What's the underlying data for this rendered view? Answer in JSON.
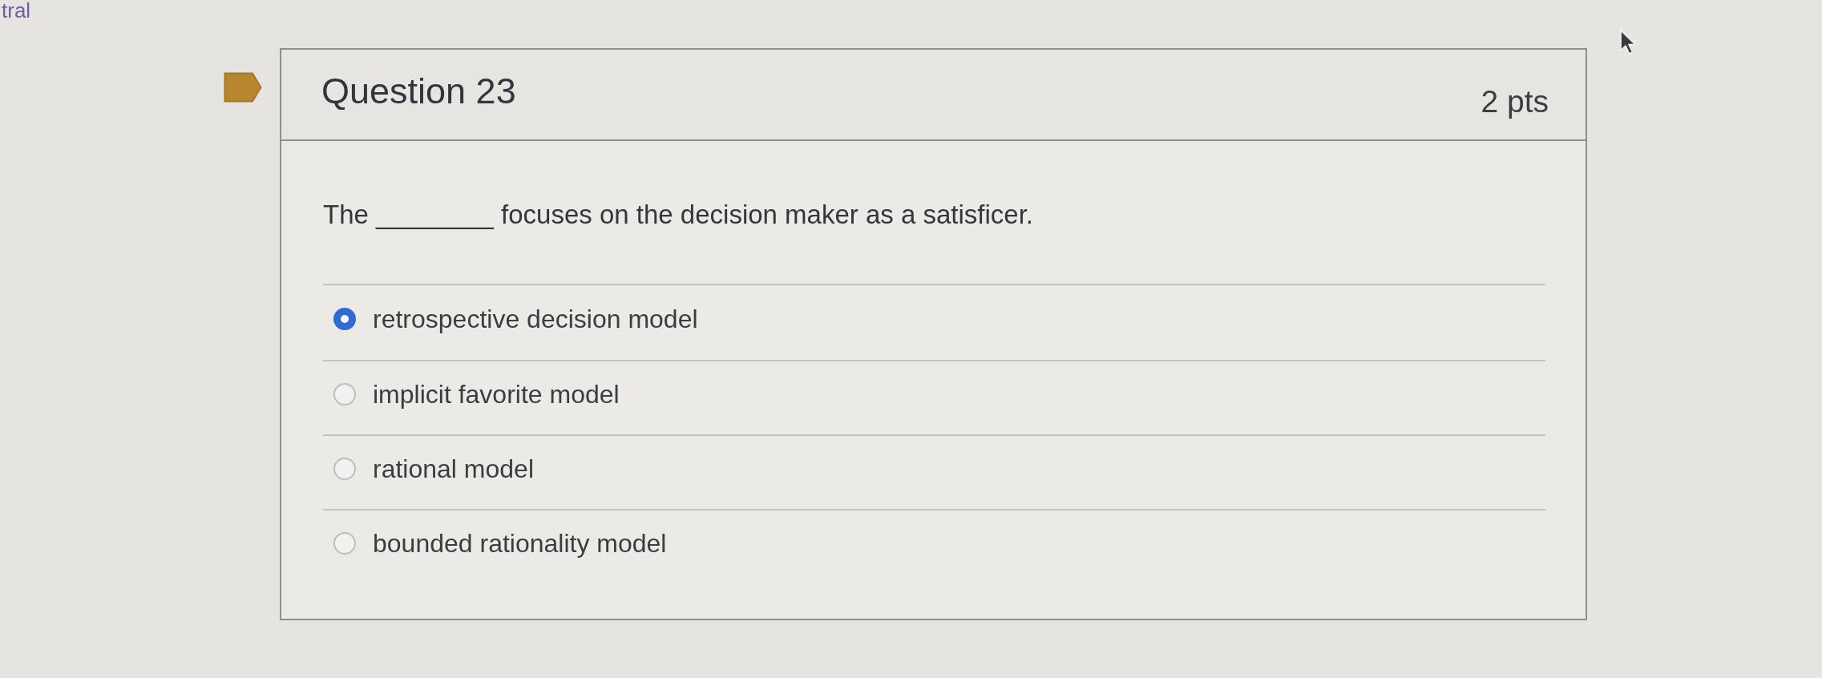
{
  "page_fragment": {
    "text": "tral"
  },
  "question": {
    "flagged": true,
    "title": "Question 23",
    "points": "2 pts",
    "prompt": "The ________ focuses on the decision maker as a satisficer.",
    "options": [
      {
        "label": "retrospective decision model",
        "selected": true
      },
      {
        "label": "implicit favorite model",
        "selected": false
      },
      {
        "label": "rational model",
        "selected": false
      },
      {
        "label": "bounded rationality model",
        "selected": false
      }
    ]
  }
}
